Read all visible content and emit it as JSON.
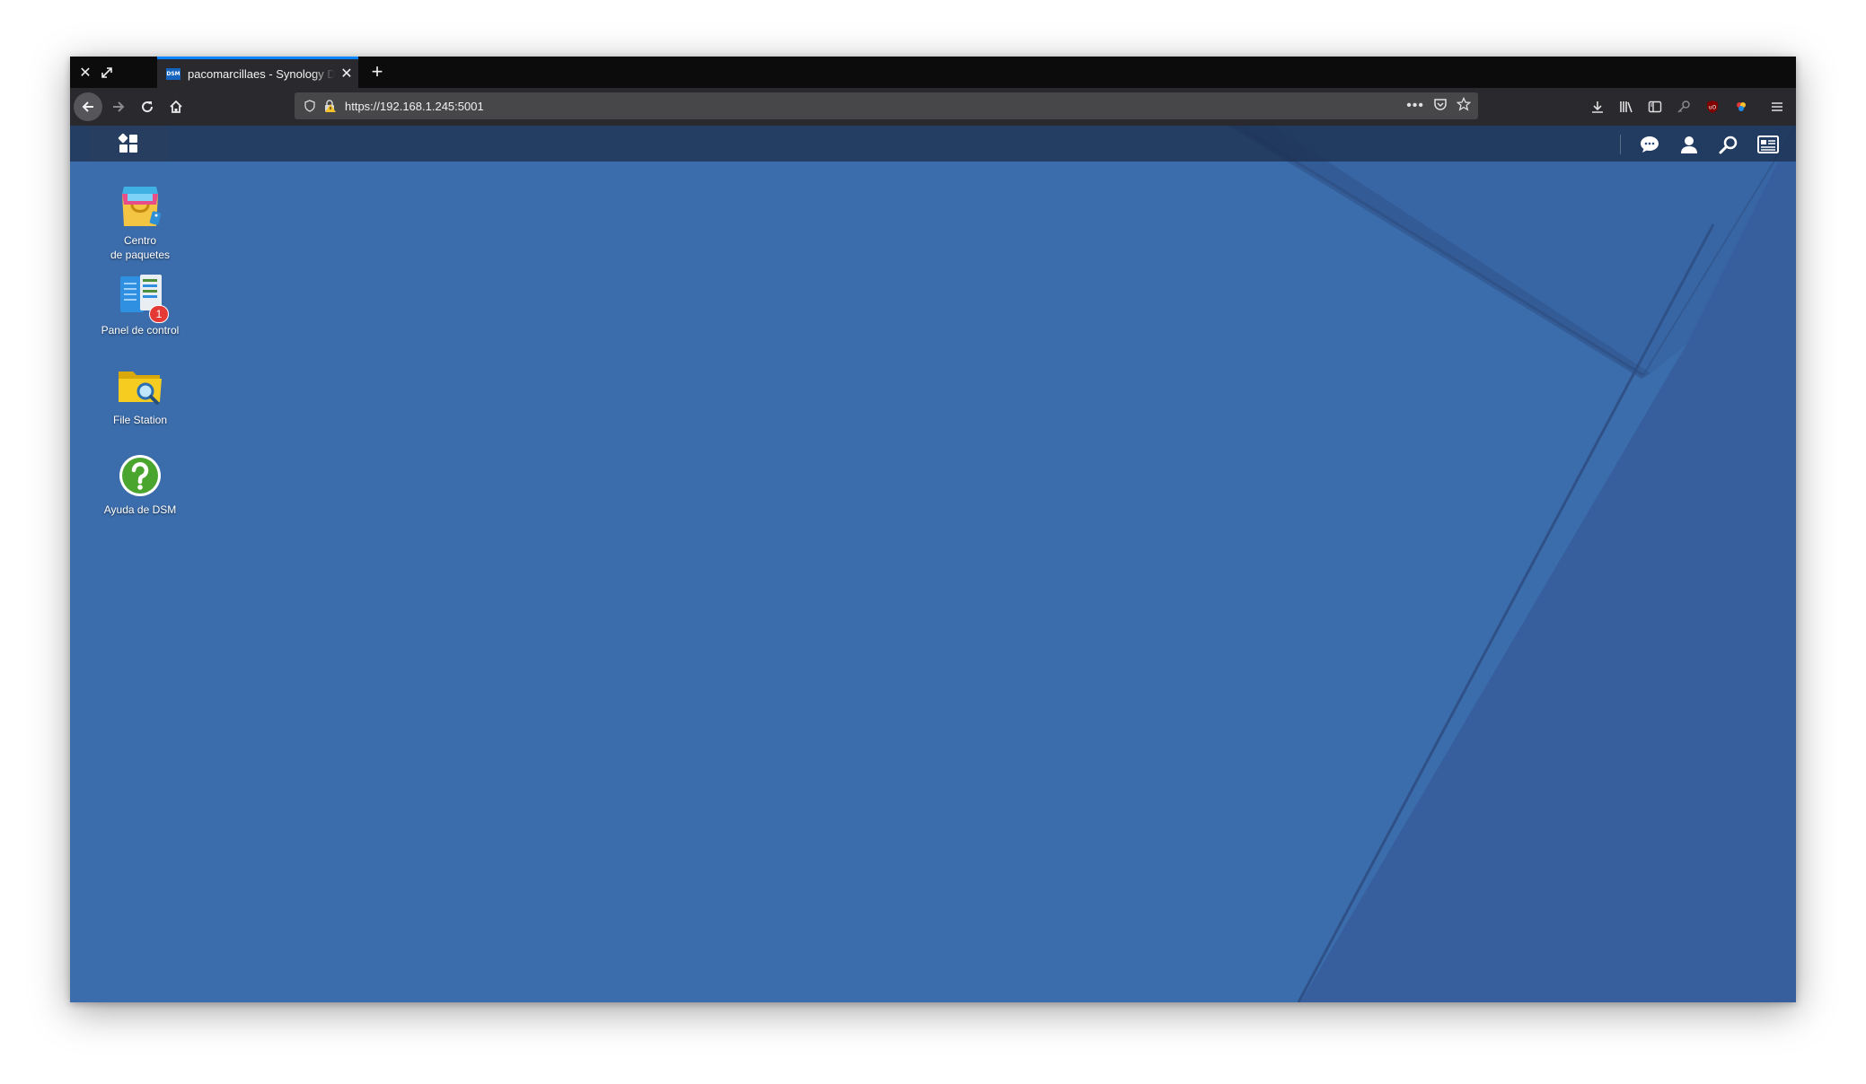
{
  "browser": {
    "tab": {
      "favicon_text": "DSM",
      "title": "pacomarcillaes - Synology DiskStation"
    },
    "url": "https://192.168.1.245:5001"
  },
  "desktop": {
    "icons": [
      {
        "label": "Centro\nde paquetes",
        "icon": "package-center-icon"
      },
      {
        "label": "Panel de control",
        "icon": "control-panel-icon",
        "badge": "1"
      },
      {
        "label": "File Station",
        "icon": "file-station-icon"
      },
      {
        "label": "Ayuda de DSM",
        "icon": "dsm-help-icon"
      }
    ]
  },
  "colors": {
    "wallpaper": "#3b6cab",
    "taskbar": "#1c304e",
    "tab_accent": "#0a84ff",
    "badge": "#e53935"
  }
}
